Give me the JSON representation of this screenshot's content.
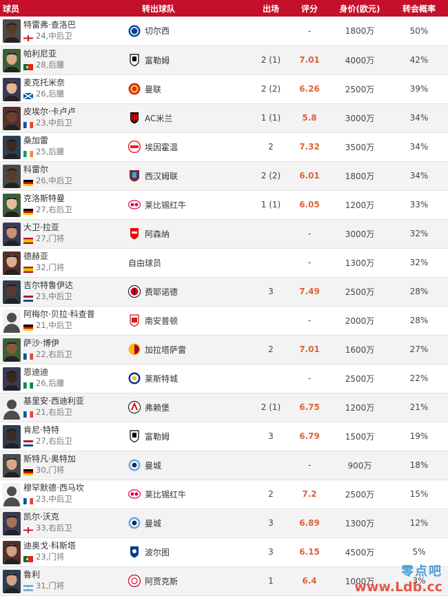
{
  "header": {
    "player": "球员",
    "team": "转出球队",
    "apps": "出场",
    "rating": "评分",
    "value": "身价(欧元)",
    "prob": "转会概率"
  },
  "colors": {
    "header_bg": "#c4102a",
    "rating": "#e0623a",
    "row_alt": "#f3f3f3"
  },
  "rows": [
    {
      "name": "特雷弗·查洛巴",
      "age": "24",
      "pos": "中后卫",
      "flag": "england",
      "team": "切尔西",
      "badge": "chelsea-badge-icon",
      "apps": "",
      "rating": "",
      "value": "1800万",
      "prob": "50%",
      "skin": "#5a3a2a"
    },
    {
      "name": "帕利尼亚",
      "age": "28",
      "pos": "后腰",
      "flag": "portugal",
      "team": "富勒姆",
      "badge": "fulham-badge-icon",
      "apps": "2 (1)",
      "rating": "7.01",
      "value": "4000万",
      "prob": "42%",
      "skin": "#d9a98a"
    },
    {
      "name": "麦克托米奈",
      "age": "26",
      "pos": "后腰",
      "flag": "scotland",
      "team": "曼联",
      "badge": "man-utd-badge-icon",
      "apps": "2 (2)",
      "rating": "6.26",
      "value": "2500万",
      "prob": "39%",
      "skin": "#e3b596"
    },
    {
      "name": "皮埃尔·卡卢卢",
      "age": "23",
      "pos": "中后卫",
      "flag": "france",
      "team": "AC米兰",
      "badge": "ac-milan-badge-icon",
      "apps": "1 (1)",
      "rating": "5.8",
      "value": "3000万",
      "prob": "34%",
      "skin": "#6b4230"
    },
    {
      "name": "桑加雷",
      "age": "25",
      "pos": "后腰",
      "flag": "ireland",
      "team": "埃因霍温",
      "badge": "psv-badge-icon",
      "apps": "2",
      "rating": "7.32",
      "value": "3500万",
      "prob": "34%",
      "skin": "#3d2a22"
    },
    {
      "name": "科雷尔",
      "age": "26",
      "pos": "中后卫",
      "flag": "germany",
      "team": "西汉姆联",
      "badge": "west-ham-badge-icon",
      "apps": "2 (2)",
      "rating": "6.01",
      "value": "1800万",
      "prob": "34%",
      "skin": "#5b3b2a"
    },
    {
      "name": "克洛斯特曼",
      "age": "27",
      "pos": "右后卫",
      "flag": "germany",
      "team": "莱比锡红牛",
      "badge": "leipzig-badge-icon",
      "apps": "1 (1)",
      "rating": "6.05",
      "value": "1200万",
      "prob": "33%",
      "skin": "#e6bb9c"
    },
    {
      "name": "大卫·拉亚",
      "age": "27",
      "pos": "门将",
      "flag": "spain",
      "team": "阿森纳",
      "badge": "arsenal-badge-icon",
      "apps": "",
      "rating": "",
      "value": "3000万",
      "prob": "32%",
      "skin": "#c89172"
    },
    {
      "name": "德赫亚",
      "age": "32",
      "pos": "门将",
      "flag": "spain",
      "team": "自由球员",
      "badge": "",
      "apps": "",
      "rating": "",
      "value": "1300万",
      "prob": "32%",
      "skin": "#dcae90"
    },
    {
      "name": "吉尔特鲁伊达",
      "age": "23",
      "pos": "中后卫",
      "flag": "netherlands",
      "team": "费耶诺德",
      "badge": "feyenoord-badge-icon",
      "apps": "3",
      "rating": "7.49",
      "value": "2500万",
      "prob": "28%",
      "skin": "#5a3a2a"
    },
    {
      "name": "阿梅尔·贝拉·科查普",
      "age": "21",
      "pos": "中后卫",
      "flag": "germany",
      "team": "南安普顿",
      "badge": "southampton-badge-icon",
      "apps": "",
      "rating": "",
      "value": "2000万",
      "prob": "28%",
      "skin": "#555555"
    },
    {
      "name": "萨沙·博伊",
      "age": "22",
      "pos": "右后卫",
      "flag": "france",
      "team": "加拉塔萨雷",
      "badge": "galatasaray-badge-icon",
      "apps": "2",
      "rating": "7.01",
      "value": "1600万",
      "prob": "27%",
      "skin": "#8a5a3c"
    },
    {
      "name": "恩迪迪",
      "age": "26",
      "pos": "后腰",
      "flag": "nigeria",
      "team": "莱斯特城",
      "badge": "leicester-badge-icon",
      "apps": "",
      "rating": "",
      "value": "2500万",
      "prob": "22%",
      "skin": "#3a2620"
    },
    {
      "name": "基里安·西迪利亚",
      "age": "21",
      "pos": "右后卫",
      "flag": "france",
      "team": "弗赖堡",
      "badge": "freiburg-badge-icon",
      "apps": "2 (1)",
      "rating": "6.75",
      "value": "1200万",
      "prob": "21%",
      "skin": "#555555"
    },
    {
      "name": "肯尼·特特",
      "age": "27",
      "pos": "右后卫",
      "flag": "netherlands",
      "team": "富勒姆",
      "badge": "fulham-badge-icon",
      "apps": "3",
      "rating": "6.79",
      "value": "1500万",
      "prob": "19%",
      "skin": "#3d2a22"
    },
    {
      "name": "斯特凡·奥特加",
      "age": "30",
      "pos": "门将",
      "flag": "germany",
      "team": "曼城",
      "badge": "man-city-badge-icon",
      "apps": "",
      "rating": "",
      "value": "900万",
      "prob": "18%",
      "skin": "#d7a88a"
    },
    {
      "name": "穆罕默德·西马坎",
      "age": "23",
      "pos": "中后卫",
      "flag": "france",
      "team": "莱比锡红牛",
      "badge": "leipzig-badge-icon",
      "apps": "2",
      "rating": "7.2",
      "value": "2500万",
      "prob": "15%",
      "skin": "#555555"
    },
    {
      "name": "凯尔·沃克",
      "age": "33",
      "pos": "右后卫",
      "flag": "england",
      "team": "曼城",
      "badge": "man-city-badge-icon",
      "apps": "3",
      "rating": "6.89",
      "value": "1300万",
      "prob": "12%",
      "skin": "#a4735a"
    },
    {
      "name": "迪奥戈·科斯塔",
      "age": "23",
      "pos": "门将",
      "flag": "portugal",
      "team": "波尔图",
      "badge": "porto-badge-icon",
      "apps": "3",
      "rating": "6.15",
      "value": "4500万",
      "prob": "5%",
      "skin": "#d0a084"
    },
    {
      "name": "鲁利",
      "age": "31",
      "pos": "门将",
      "flag": "argentina",
      "team": "阿贾克斯",
      "badge": "ajax-badge-icon",
      "apps": "1",
      "rating": "6.4",
      "value": "1000万",
      "prob": "3%",
      "skin": "#d4a283"
    }
  ],
  "watermark": {
    "logo": "零点吧",
    "url": "www.Ldb.cc"
  }
}
